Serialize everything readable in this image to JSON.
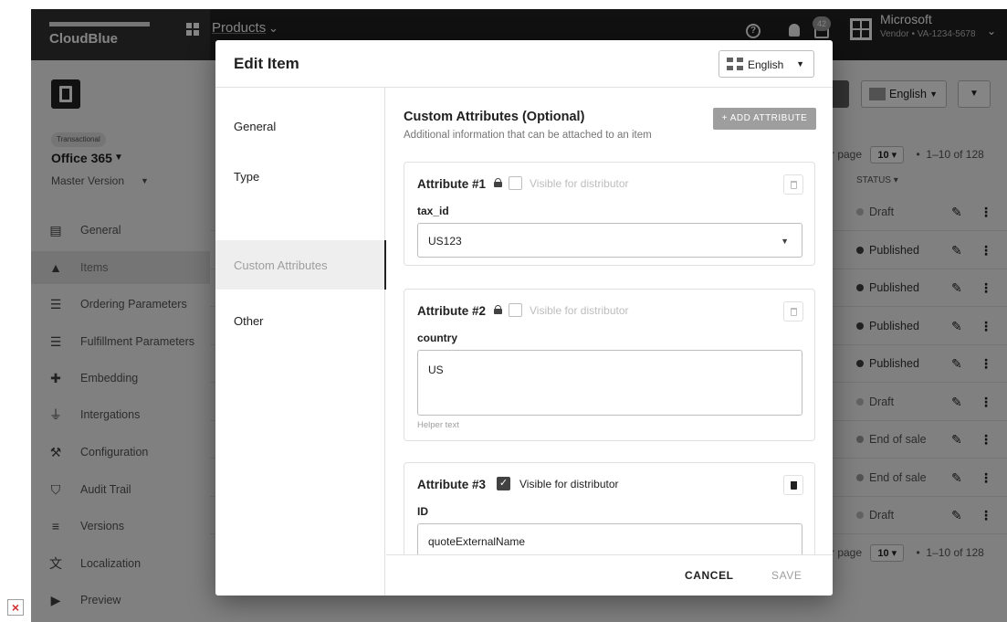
{
  "topbar": {
    "brand": "CloudBlue",
    "products_label": "Products",
    "notification_count": "42",
    "vendor_name": "Microsoft",
    "vendor_id": "Vendor • VA-1234-5678"
  },
  "sidebar": {
    "product_tag": "Transactional",
    "product_name": "Office 365",
    "version": "Master Version",
    "items": [
      {
        "label": "General",
        "icon": "clipboard-icon"
      },
      {
        "label": "Items",
        "icon": "shapes-icon",
        "active": true
      },
      {
        "label": "Ordering Parameters",
        "icon": "checklist-icon"
      },
      {
        "label": "Fulfillment Parameters",
        "icon": "checklist-icon"
      },
      {
        "label": "Embedding",
        "icon": "puzzle-icon"
      },
      {
        "label": "Intergations",
        "icon": "plug-icon"
      },
      {
        "label": "Configuration",
        "icon": "wrench-icon"
      },
      {
        "label": "Audit Trail",
        "icon": "shield-icon"
      },
      {
        "label": "Versions",
        "icon": "list-icon"
      },
      {
        "label": "Localization",
        "icon": "translate-icon"
      },
      {
        "label": "Preview",
        "icon": "play-icon"
      }
    ]
  },
  "background": {
    "language": "English",
    "per_page_label": "r page",
    "per_page_value": "10",
    "range": "1–10 of 128",
    "status_header": "STATUS",
    "rows": [
      {
        "status": "Draft",
        "kind": "draft"
      },
      {
        "status": "Published",
        "kind": "pub"
      },
      {
        "status": "Published",
        "kind": "pub"
      },
      {
        "status": "Published",
        "kind": "pub"
      },
      {
        "status": "Published",
        "kind": "pub"
      },
      {
        "status": "Draft",
        "kind": "draft"
      },
      {
        "status": "End of sale",
        "kind": "eos"
      },
      {
        "status": "End of sale",
        "kind": "eos"
      },
      {
        "status": "Draft",
        "kind": "draft"
      }
    ]
  },
  "modal": {
    "title": "Edit Item",
    "language": "English",
    "nav": [
      {
        "label": "General"
      },
      {
        "label": "Type"
      },
      {
        "label": "Custom Attributes",
        "active": true
      },
      {
        "label": "Other"
      }
    ],
    "section_title": "Custom Attributes (Optional)",
    "section_subtitle": "Additional information that can be attached to an item",
    "add_attribute_label": "+ ADD ATTRIBUTE",
    "attributes": [
      {
        "title": "Attribute #1",
        "visible_label": "Visible for distributor",
        "visible": false,
        "field_label": "tax_id",
        "value": "US123"
      },
      {
        "title": "Attribute #2",
        "visible_label": "Visible for distributor",
        "visible": false,
        "field_label": "country",
        "value": "US",
        "helper": "Helper text"
      },
      {
        "title": "Attribute #3",
        "visible_label": "Visible for distributor",
        "visible": true,
        "field_label": "ID",
        "value": "quoteExternalName"
      }
    ],
    "cancel_label": "CANCEL",
    "save_label": "SAVE"
  },
  "colors": {
    "topbar": "#212121",
    "accent": "#424242",
    "disabled": "#9e9e9e"
  }
}
